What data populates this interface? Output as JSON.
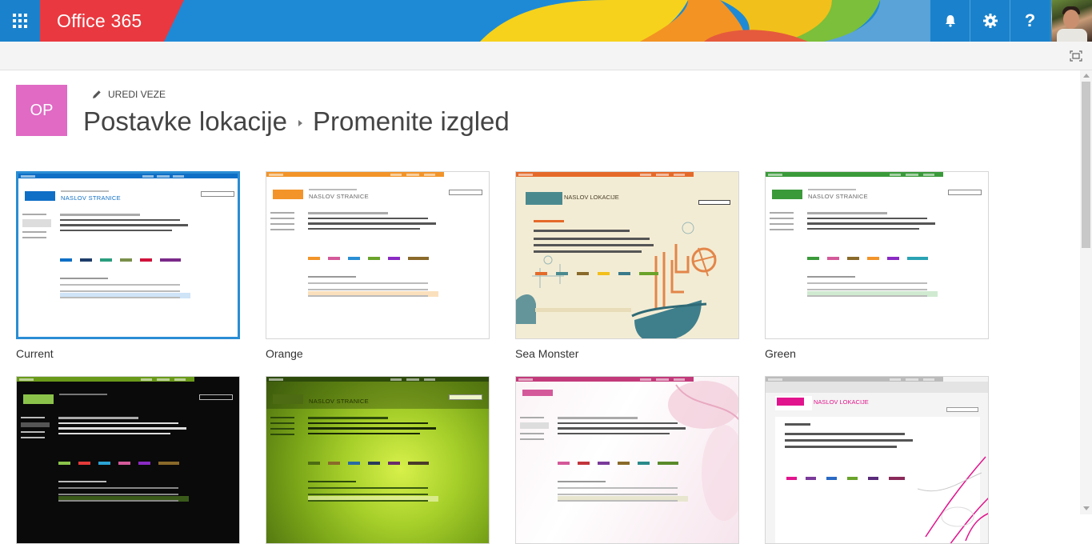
{
  "suite_bar": {
    "brand": "Office 365",
    "app_launcher_icon": "waffle-icon",
    "notifications_icon": "bell-icon",
    "settings_icon": "gear-icon",
    "help_label": "?",
    "colors": {
      "bar": "#1e8ad6",
      "button": "#1a82cc",
      "accent_red": "#e9383f",
      "accent_yellow": "#f6d21c",
      "accent_orange": "#f39323"
    }
  },
  "ribbon": {
    "focus_icon": "focus-on-content-icon"
  },
  "site": {
    "logo_text": "OP",
    "logo_color": "#e06ac4",
    "edit_links_label": "UREDI VEZE",
    "breadcrumb": [
      "Postavke lokacije",
      "Promenite izgled"
    ]
  },
  "designs": [
    {
      "name": "Current",
      "selected": true,
      "accent": "#0f6fc6",
      "background": "#ffffff",
      "text": "NASLOV STRANICE"
    },
    {
      "name": "Orange",
      "selected": false,
      "accent": "#f29429",
      "background": "#ffffff",
      "text": "NASLOV STRANICE"
    },
    {
      "name": "Sea Monster",
      "selected": false,
      "accent": "#4a8a8f",
      "background": "#f3ecd4",
      "text": "NASLOV LOKACIJE"
    },
    {
      "name": "Green",
      "selected": false,
      "accent": "#3a9a3a",
      "background": "#ffffff",
      "text": "NASLOV STRANICE"
    },
    {
      "name": "",
      "selected": false,
      "accent": "#8bc34a",
      "background": "#0a0a0a",
      "text": ""
    },
    {
      "name": "",
      "selected": false,
      "accent": "#4d6b12",
      "background": "#9cc92a",
      "text": "NASLOV STRANICE"
    },
    {
      "name": "",
      "selected": false,
      "accent": "#d4599a",
      "background": "#fbf3f6",
      "text": ""
    },
    {
      "name": "",
      "selected": false,
      "accent": "#e2148d",
      "background": "#f4f4f4",
      "text": "NASLOV LOKACIJE"
    }
  ]
}
